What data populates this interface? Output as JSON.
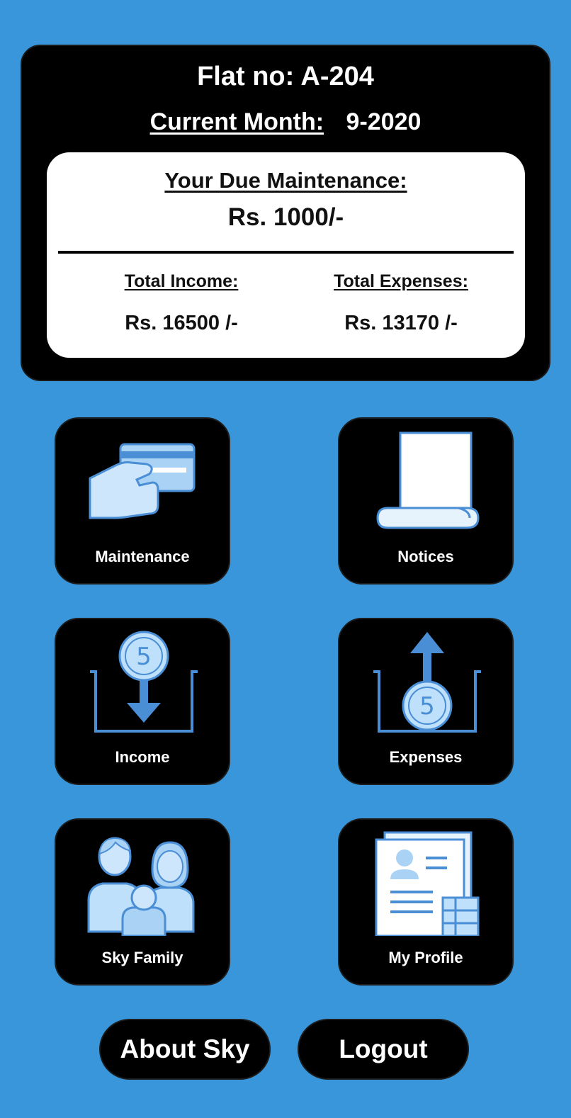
{
  "summary": {
    "flat_label": "Flat no: A-204",
    "month_label": "Current Month:",
    "month_value": "9-2020",
    "due_label": "Your Due Maintenance:",
    "due_value": "Rs. 1000/-",
    "income_label": "Total Income:",
    "income_value": "Rs. 16500 /-",
    "expenses_label": "Total Expenses:",
    "expenses_value": "Rs. 13170 /-"
  },
  "tiles": {
    "maintenance": {
      "label": "Maintenance",
      "icon": "card-payment-icon"
    },
    "notices": {
      "label": "Notices",
      "icon": "scroll-icon"
    },
    "income": {
      "label": "Income",
      "icon": "coin-in-icon",
      "coin": "5"
    },
    "expenses": {
      "label": "Expenses",
      "icon": "coin-out-icon",
      "coin": "5"
    },
    "family": {
      "label": "Sky Family",
      "icon": "family-icon"
    },
    "profile": {
      "label": "My Profile",
      "icon": "profile-document-icon"
    }
  },
  "buttons": {
    "about": "About Sky",
    "logout": "Logout"
  },
  "colors": {
    "background": "#3a96da",
    "card": "#000000",
    "icon_fill": "#bfe0fb",
    "icon_stroke": "#4a8ed6"
  }
}
